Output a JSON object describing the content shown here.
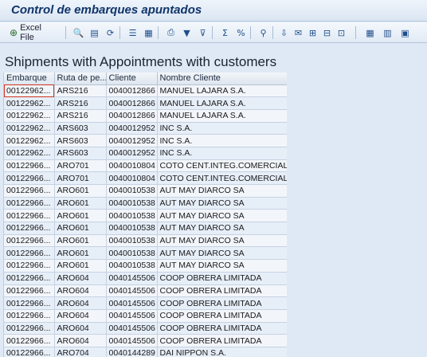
{
  "window": {
    "title": "Control de embarques apuntados"
  },
  "toolbar": {
    "excel_label": "Excel File",
    "icons": [
      "details-icon",
      "sort-ascending-icon",
      "refresh-icon",
      "list-icon",
      "report-icon",
      "print-icon",
      "filter-icon",
      "filter-set-icon",
      "sum-icon",
      "subtotal-icon",
      "find-icon",
      "export-icon",
      "send-icon",
      "layout-icon",
      "choose-layout-icon",
      "save-layout-icon",
      "table-icon",
      "columns-icon",
      "grid-settings-icon"
    ]
  },
  "grid": {
    "title": "Shipments with Appointments with customers",
    "columns": [
      "Embarque",
      "Ruta de pe...",
      "Cliente",
      "Nombre Cliente"
    ],
    "rows": [
      [
        "00122962...",
        "ARS216",
        "0040012866",
        "MANUEL LAJARA S.A."
      ],
      [
        "00122962...",
        "ARS216",
        "0040012866",
        "MANUEL LAJARA S.A."
      ],
      [
        "00122962...",
        "ARS216",
        "0040012866",
        "MANUEL LAJARA S.A."
      ],
      [
        "00122962...",
        "ARS603",
        "0040012952",
        "INC S.A."
      ],
      [
        "00122962...",
        "ARS603",
        "0040012952",
        "INC S.A."
      ],
      [
        "00122962...",
        "ARS603",
        "0040012952",
        "INC S.A."
      ],
      [
        "00122966...",
        "ARO701",
        "0040010804",
        "COTO CENT.INTEG.COMERCIALI..."
      ],
      [
        "00122966...",
        "ARO701",
        "0040010804",
        "COTO CENT.INTEG.COMERCIALI..."
      ],
      [
        "00122966...",
        "ARO601",
        "0040010538",
        "AUT MAY DIARCO SA"
      ],
      [
        "00122966...",
        "ARO601",
        "0040010538",
        "AUT MAY DIARCO SA"
      ],
      [
        "00122966...",
        "ARO601",
        "0040010538",
        "AUT MAY DIARCO SA"
      ],
      [
        "00122966...",
        "ARO601",
        "0040010538",
        "AUT MAY DIARCO SA"
      ],
      [
        "00122966...",
        "ARO601",
        "0040010538",
        "AUT MAY DIARCO SA"
      ],
      [
        "00122966...",
        "ARO601",
        "0040010538",
        "AUT MAY DIARCO SA"
      ],
      [
        "00122966...",
        "ARO601",
        "0040010538",
        "AUT MAY DIARCO SA"
      ],
      [
        "00122966...",
        "ARO604",
        "0040145506",
        "COOP OBRERA LIMITADA"
      ],
      [
        "00122966...",
        "ARO604",
        "0040145506",
        "COOP OBRERA LIMITADA"
      ],
      [
        "00122966...",
        "ARO604",
        "0040145506",
        "COOP OBRERA LIMITADA"
      ],
      [
        "00122966...",
        "ARO604",
        "0040145506",
        "COOP OBRERA LIMITADA"
      ],
      [
        "00122966...",
        "ARO604",
        "0040145506",
        "COOP OBRERA LIMITADA"
      ],
      [
        "00122966...",
        "ARO604",
        "0040145506",
        "COOP OBRERA LIMITADA"
      ],
      [
        "00122966...",
        "ARO704",
        "0040144289",
        "DAI NIPPON S.A."
      ]
    ]
  }
}
